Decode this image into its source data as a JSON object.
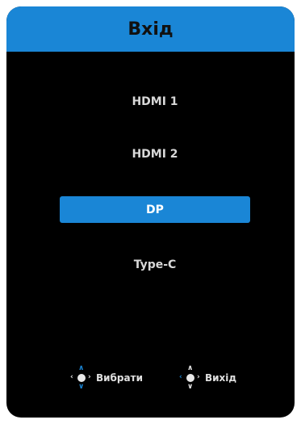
{
  "header": {
    "title": "Вхід"
  },
  "menu": {
    "items": [
      {
        "label": "HDMI 1",
        "selected": false
      },
      {
        "label": "HDMI 2",
        "selected": false
      },
      {
        "label": "DP",
        "selected": true
      },
      {
        "label": "Type-C",
        "selected": false
      }
    ]
  },
  "footer": {
    "select_label": "Вибрати",
    "exit_label": "Вихід"
  },
  "icons": {
    "select": "joystick-up-down-icon",
    "exit": "joystick-left-icon"
  },
  "colors": {
    "accent": "#1a86d6",
    "background": "#000000",
    "text": "#d8d8d8"
  }
}
